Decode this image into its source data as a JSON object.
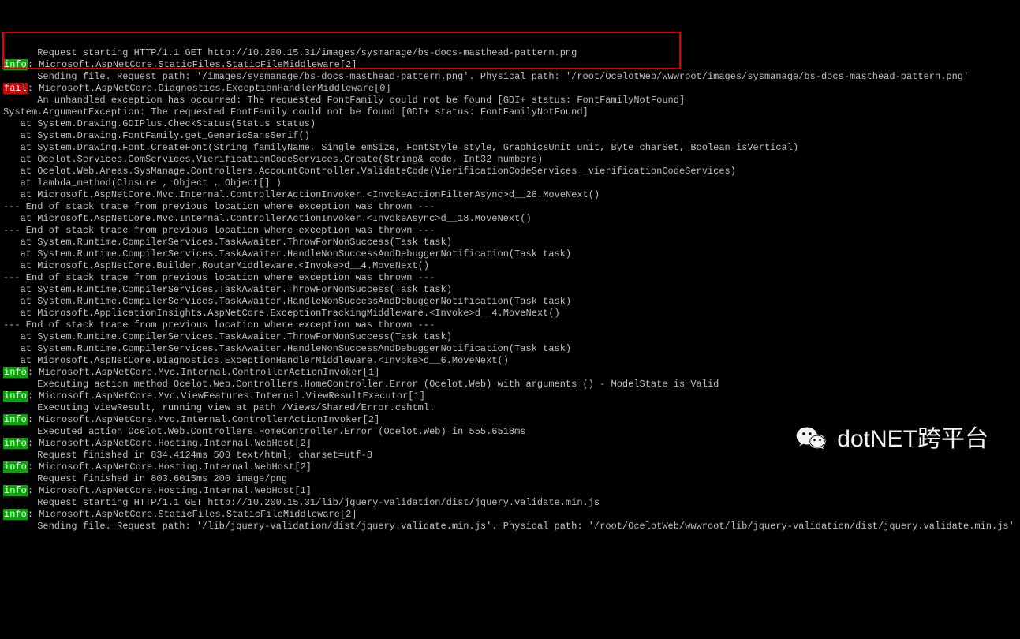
{
  "tags": {
    "info": "info",
    "fail": "fail"
  },
  "lines": [
    {
      "indent": "      ",
      "text": "Request starting HTTP/1.1 GET http://10.200.15.31/images/sysmanage/bs-docs-masthead-pattern.png"
    },
    {
      "tag": "info",
      "text": ": Microsoft.AspNetCore.StaticFiles.StaticFileMiddleware[2]"
    },
    {
      "indent": "      ",
      "text": "Sending file. Request path: '/images/sysmanage/bs-docs-masthead-pattern.png'. Physical path: '/root/OcelotWeb/wwwroot/images/sysmanage/bs-docs-masthead-pattern.png'"
    },
    {
      "tag": "fail",
      "text": ": Microsoft.AspNetCore.Diagnostics.ExceptionHandlerMiddleware[0]"
    },
    {
      "indent": "      ",
      "text": "An unhandled exception has occurred: The requested FontFamily could not be found [GDI+ status: FontFamilyNotFound]"
    },
    {
      "indent": "",
      "text": "System.ArgumentException: The requested FontFamily could not be found [GDI+ status: FontFamilyNotFound]"
    },
    {
      "indent": "   ",
      "text": "at System.Drawing.GDIPlus.CheckStatus(Status status)"
    },
    {
      "indent": "   ",
      "text": "at System.Drawing.FontFamily.get_GenericSansSerif()"
    },
    {
      "indent": "   ",
      "text": "at System.Drawing.Font.CreateFont(String familyName, Single emSize, FontStyle style, GraphicsUnit unit, Byte charSet, Boolean isVertical)"
    },
    {
      "indent": "   ",
      "text": "at Ocelot.Services.ComServices.VierificationCodeServices.Create(String& code, Int32 numbers)"
    },
    {
      "indent": "   ",
      "text": "at Ocelot.Web.Areas.SysManage.Controllers.AccountController.ValidateCode(VierificationCodeServices _vierificationCodeServices)"
    },
    {
      "indent": "   ",
      "text": "at lambda_method(Closure , Object , Object[] )"
    },
    {
      "indent": "   ",
      "text": "at Microsoft.AspNetCore.Mvc.Internal.ControllerActionInvoker.<InvokeActionFilterAsync>d__28.MoveNext()"
    },
    {
      "indent": "",
      "text": "--- End of stack trace from previous location where exception was thrown ---"
    },
    {
      "indent": "   ",
      "text": "at Microsoft.AspNetCore.Mvc.Internal.ControllerActionInvoker.<InvokeAsync>d__18.MoveNext()"
    },
    {
      "indent": "",
      "text": "--- End of stack trace from previous location where exception was thrown ---"
    },
    {
      "indent": "   ",
      "text": "at System.Runtime.CompilerServices.TaskAwaiter.ThrowForNonSuccess(Task task)"
    },
    {
      "indent": "   ",
      "text": "at System.Runtime.CompilerServices.TaskAwaiter.HandleNonSuccessAndDebuggerNotification(Task task)"
    },
    {
      "indent": "   ",
      "text": "at Microsoft.AspNetCore.Builder.RouterMiddleware.<Invoke>d__4.MoveNext()"
    },
    {
      "indent": "",
      "text": "--- End of stack trace from previous location where exception was thrown ---"
    },
    {
      "indent": "   ",
      "text": "at System.Runtime.CompilerServices.TaskAwaiter.ThrowForNonSuccess(Task task)"
    },
    {
      "indent": "   ",
      "text": "at System.Runtime.CompilerServices.TaskAwaiter.HandleNonSuccessAndDebuggerNotification(Task task)"
    },
    {
      "indent": "   ",
      "text": "at Microsoft.ApplicationInsights.AspNetCore.ExceptionTrackingMiddleware.<Invoke>d__4.MoveNext()"
    },
    {
      "indent": "",
      "text": "--- End of stack trace from previous location where exception was thrown ---"
    },
    {
      "indent": "   ",
      "text": "at System.Runtime.CompilerServices.TaskAwaiter.ThrowForNonSuccess(Task task)"
    },
    {
      "indent": "   ",
      "text": "at System.Runtime.CompilerServices.TaskAwaiter.HandleNonSuccessAndDebuggerNotification(Task task)"
    },
    {
      "indent": "   ",
      "text": "at Microsoft.AspNetCore.Diagnostics.ExceptionHandlerMiddleware.<Invoke>d__6.MoveNext()"
    },
    {
      "tag": "info",
      "text": ": Microsoft.AspNetCore.Mvc.Internal.ControllerActionInvoker[1]"
    },
    {
      "indent": "      ",
      "text": "Executing action method Ocelot.Web.Controllers.HomeController.Error (Ocelot.Web) with arguments () - ModelState is Valid"
    },
    {
      "tag": "info",
      "text": ": Microsoft.AspNetCore.Mvc.ViewFeatures.Internal.ViewResultExecutor[1]"
    },
    {
      "indent": "      ",
      "text": "Executing ViewResult, running view at path /Views/Shared/Error.cshtml."
    },
    {
      "tag": "info",
      "text": ": Microsoft.AspNetCore.Mvc.Internal.ControllerActionInvoker[2]"
    },
    {
      "indent": "      ",
      "text": "Executed action Ocelot.Web.Controllers.HomeController.Error (Ocelot.Web) in 555.6518ms"
    },
    {
      "tag": "info",
      "text": ": Microsoft.AspNetCore.Hosting.Internal.WebHost[2]"
    },
    {
      "indent": "      ",
      "text": "Request finished in 834.4124ms 500 text/html; charset=utf-8"
    },
    {
      "tag": "info",
      "text": ": Microsoft.AspNetCore.Hosting.Internal.WebHost[2]"
    },
    {
      "indent": "      ",
      "text": "Request finished in 803.6015ms 200 image/png"
    },
    {
      "tag": "info",
      "text": ": Microsoft.AspNetCore.Hosting.Internal.WebHost[1]"
    },
    {
      "indent": "      ",
      "text": "Request starting HTTP/1.1 GET http://10.200.15.31/lib/jquery-validation/dist/jquery.validate.min.js"
    },
    {
      "tag": "info",
      "text": ": Microsoft.AspNetCore.StaticFiles.StaticFileMiddleware[2]"
    },
    {
      "indent": "      ",
      "text": "Sending file. Request path: '/lib/jquery-validation/dist/jquery.validate.min.js'. Physical path: '/root/OcelotWeb/wwwroot/lib/jquery-validation/dist/jquery.validate.min.js'"
    }
  ],
  "watermark": {
    "text": "dotNET跨平台"
  }
}
